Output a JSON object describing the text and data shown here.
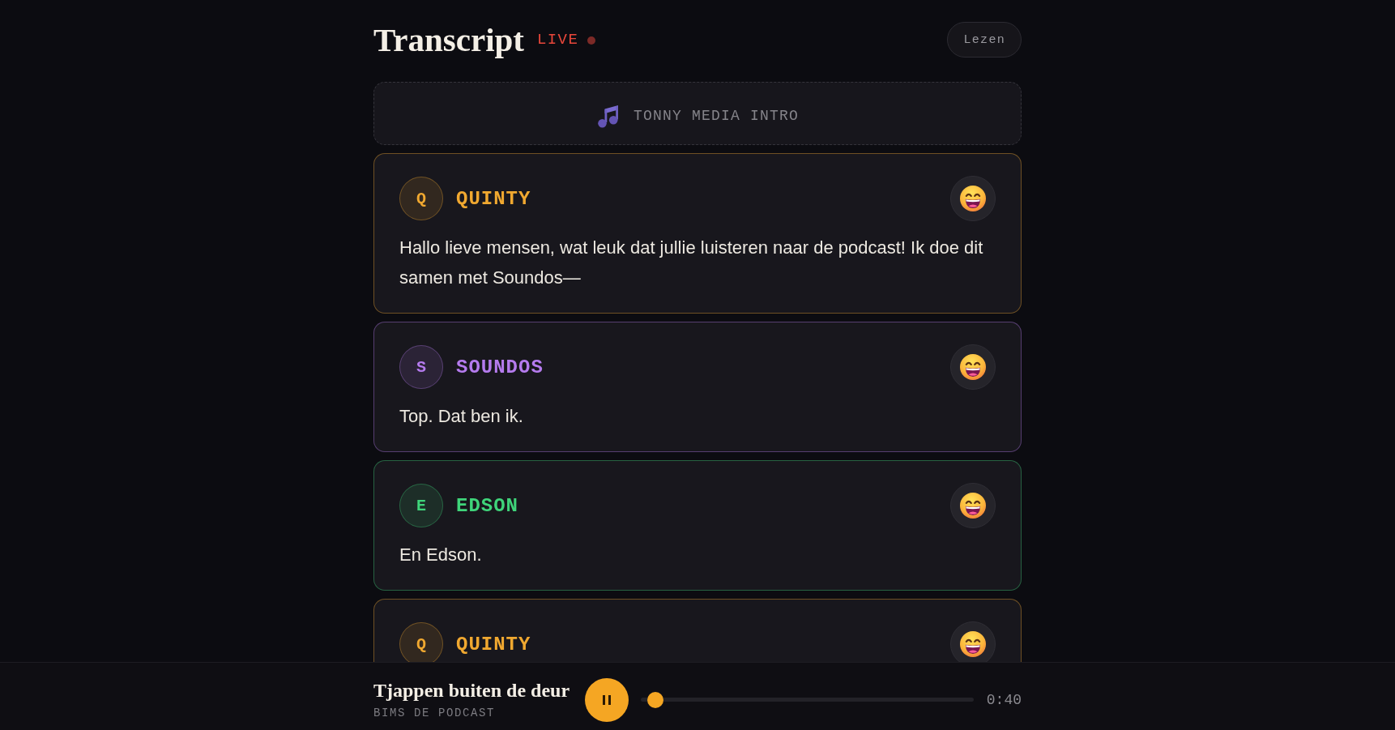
{
  "header": {
    "title": "Transcript",
    "live_label": "LIVE",
    "read_button": "Lezen"
  },
  "intro": {
    "label": "TONNY MEDIA INTRO"
  },
  "entries": [
    {
      "speaker": "QUINTY",
      "initial": "Q",
      "color": "#f0a830",
      "text": "Hallo lieve mensen, wat leuk dat jullie luisteren naar de podcast! Ik doe dit samen met Soundos—"
    },
    {
      "speaker": "SOUNDOS",
      "initial": "S",
      "color": "#b57bee",
      "text": "Top. Dat ben ik."
    },
    {
      "speaker": "EDSON",
      "initial": "E",
      "color": "#3fd47a",
      "text": "En Edson."
    },
    {
      "speaker": "QUINTY",
      "initial": "Q",
      "color": "#f0a830"
    }
  ],
  "player": {
    "title": "Tjappen buiten de deur",
    "subtitle": "BIMS DE PODCAST",
    "playing": true,
    "level": 0.044,
    "time": "0:40"
  }
}
